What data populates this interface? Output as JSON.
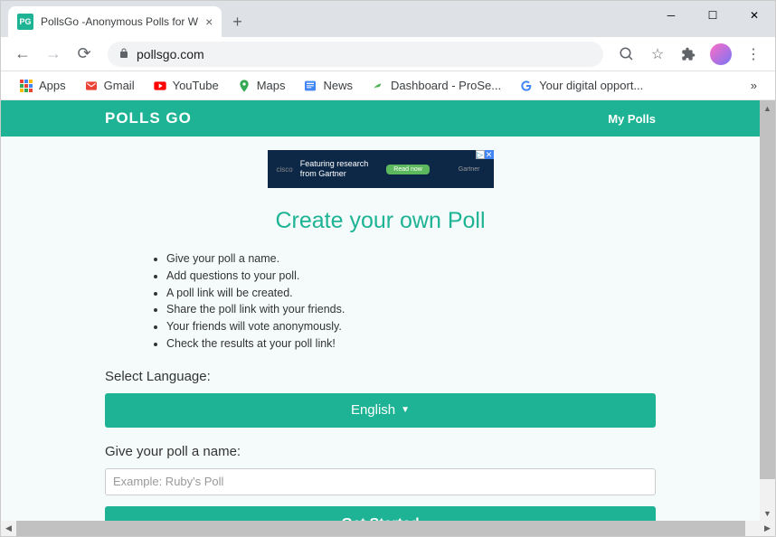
{
  "tab": {
    "favicon": "PG",
    "title": "PollsGo -Anonymous Polls for W"
  },
  "url": "pollsgo.com",
  "bookmarks": [
    {
      "label": "Apps"
    },
    {
      "label": "Gmail"
    },
    {
      "label": "YouTube"
    },
    {
      "label": "Maps"
    },
    {
      "label": "News"
    },
    {
      "label": "Dashboard - ProSe..."
    },
    {
      "label": "Your digital opport..."
    }
  ],
  "header": {
    "logo": "POLLS GO",
    "my_polls": "My Polls"
  },
  "ad": {
    "brand": "cisco",
    "text1": "Featuring research",
    "text2": "from Gartner",
    "cta": "Read now",
    "partner": "Gartner"
  },
  "page": {
    "title": "Create your own Poll",
    "instructions": [
      "Give your poll a name.",
      "Add questions to your poll.",
      "A poll link will be created.",
      "Share the poll link with your friends.",
      "Your friends will vote anonymously.",
      "Check the results at your poll link!"
    ],
    "lang_label": "Select Language:",
    "lang_value": "English",
    "name_label": "Give your poll a name:",
    "name_placeholder": "Example: Ruby's Poll",
    "submit": "Get Started"
  }
}
